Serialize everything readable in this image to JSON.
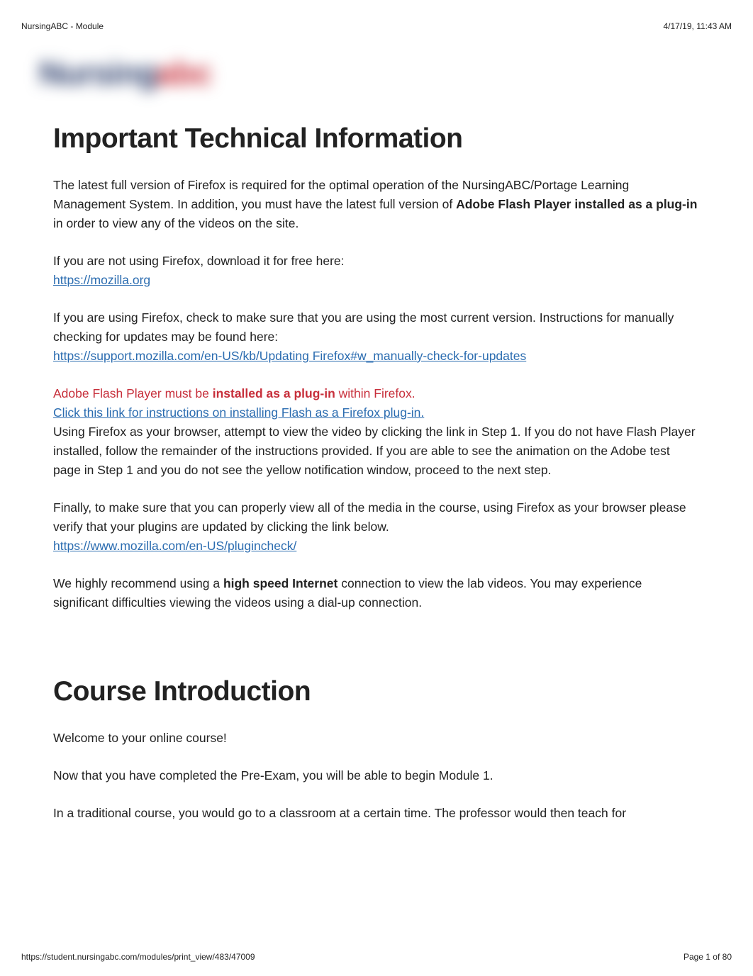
{
  "header": {
    "left": "NursingABC - Module",
    "right": "4/17/19, 11:43 AM"
  },
  "logo": {
    "part1": "Nursing",
    "part2": "abc"
  },
  "section1": {
    "heading": "Important Technical Information",
    "p1_a": "The latest full version of Firefox is required for the optimal operation of the NursingABC/Portage Learning Management System.  In addition, you must have the latest full version of ",
    "p1_bold": "Adobe Flash Player installed as a plug-in",
    "p1_b": " in order to view any of the videos on the site.",
    "p2": "If you are not using Firefox, download it for free here:",
    "link_mozilla": "https://mozilla.org",
    "p3": "If you are using Firefox, check to make sure that you are using the most current version. Instructions for manually checking for updates may be found here:",
    "link_support": "https://support.mozilla.com/en-US/kb/Updating Firefox#w_manually-check-for-updates",
    "red_a": "Adobe Flash Player must be ",
    "red_bold": "installed as a plug-in",
    "red_b": " within Firefox.",
    "link_flash_instr": "Click this link for instructions on installing Flash as a Firefox plug-in.",
    "p4": "Using Firefox as your browser, attempt to view the video by clicking the link in Step 1.  If you do not have Flash Player installed, follow the remainder of the instructions provided.  If you are able to see the animation on the Adobe test page in Step 1 and you do not see the yellow notification window, proceed to the next step.",
    "p5": "Finally, to make sure that you can properly view all of the media in the course, using Firefox as your browser please verify that your plugins are updated by clicking the link below.",
    "link_plugincheck": "https://www.mozilla.com/en-US/plugincheck/",
    "p6_a": "We highly recommend using a ",
    "p6_bold": "high speed Internet",
    "p6_b": " connection to view the lab videos.  You may experience significant difficulties viewing the videos using a dial-up connection."
  },
  "section2": {
    "heading": "Course Introduction",
    "p1": "Welcome to your online course!",
    "p2": "Now that you have completed the Pre-Exam, you will be able to begin Module 1.",
    "p3": "In a traditional course, you would go to a classroom at a certain time. The professor would then teach for"
  },
  "footer": {
    "url": "https://student.nursingabc.com/modules/print_view/483/47009",
    "page": "Page 1 of 80"
  }
}
